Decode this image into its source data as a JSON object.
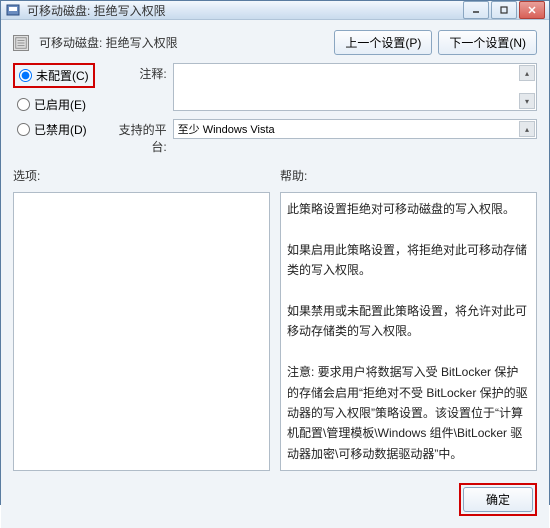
{
  "titlebar": {
    "title": "可移动磁盘: 拒绝写入权限"
  },
  "header": {
    "title": "可移动磁盘: 拒绝写入权限"
  },
  "nav": {
    "prev": "上一个设置(P)",
    "next": "下一个设置(N)"
  },
  "radios": {
    "not_configured": "未配置(C)",
    "enabled": "已启用(E)",
    "disabled": "已禁用(D)",
    "selected": "not_configured"
  },
  "fields": {
    "comment_label": "注释:",
    "comment_value": "",
    "platform_label": "支持的平台:",
    "platform_value": "至少 Windows Vista"
  },
  "panels": {
    "options_label": "选项:",
    "help_label": "帮助:",
    "help_text": "此策略设置拒绝对可移动磁盘的写入权限。\n\n如果启用此策略设置，将拒绝对此可移动存储类的写入权限。\n\n如果禁用或未配置此策略设置，将允许对此可移动存储类的写入权限。\n\n注意: 要求用户将数据写入受 BitLocker 保护的存储会启用“拒绝对不受 BitLocker 保护的驱动器的写入权限”策略设置。该设置位于“计算机配置\\管理模板\\Windows 组件\\BitLocker 驱动器加密\\可移动数据驱动器”中。"
  },
  "footer": {
    "ok": "确定"
  }
}
